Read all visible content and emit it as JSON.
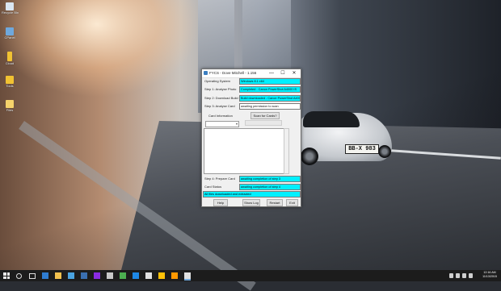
{
  "desktop": {
    "icons": [
      {
        "label": "Recycle Bin",
        "color": "#d9e6f2"
      },
      {
        "label": "CPanel",
        "color": "#6fa8dc"
      },
      {
        "label": "Cloud",
        "color": "#f1c232"
      },
      {
        "label": "Tools",
        "color": "#f1c232"
      },
      {
        "label": "Files",
        "color": "#f6d36b"
      }
    ]
  },
  "wallpaper": {
    "plate": "BB-X 983"
  },
  "window": {
    "title": "FYCS - Dove Mitchell - 1.156",
    "controls": {
      "minimize": "—",
      "maximize": "☐",
      "close": "✕"
    },
    "rows": {
      "os": {
        "label": "Operating System",
        "value": "Windows 8.1 x64"
      },
      "step1": {
        "label": "Step 1: Analyse Photo",
        "value": "Completed - Canon PowerShot A4000 IS"
      },
      "step2": {
        "label": "Step 2: Download Build",
        "value": "Build downloaded - Canon PowerShot A4000 IS"
      },
      "step3": {
        "label": "Step 3: Analyse Card",
        "value": "awaiting permission to scan"
      }
    },
    "card_info_label": "Card Information",
    "scan_button": "Scan for Cards?",
    "disabled_button": "",
    "step4": {
      "label": "Step 4: Prepare Card",
      "value": "awaiting completion of step 3"
    },
    "card_status": {
      "label": "Card Status",
      "value": "awaiting completion of step 4"
    },
    "status_line": "All files downloaded and extracted",
    "buttons": {
      "help": "Help",
      "show_log": "Show Log",
      "restart": "Restart",
      "exit": "Exit"
    }
  },
  "taskbar": {
    "clock_time": "12:16 AM",
    "clock_date": "11/13/2015",
    "colors": {
      "accent": "#00f0ff",
      "taskbar": "#1c1c1c"
    }
  }
}
